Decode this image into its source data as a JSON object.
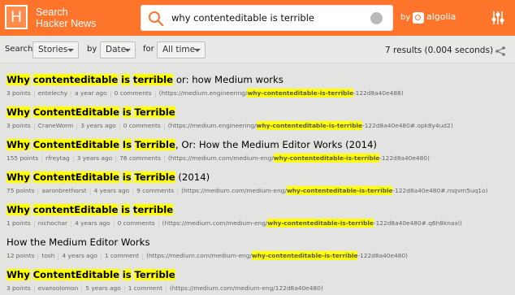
{
  "header": {
    "logo_letter": "H",
    "brand_line1": "Search",
    "brand_line2": "Hacker News",
    "search_value": "why contenteditable is terrible",
    "by_label": "by",
    "algolia_label": "algolia"
  },
  "filters": {
    "search_label": "Search",
    "type_value": "Stories",
    "by_label": "by",
    "sort_value": "Date",
    "for_label": "for",
    "range_value": "All time",
    "results": "7 results (0.004 seconds)"
  },
  "results": [
    {
      "title": [
        {
          "t": "Why",
          "h": true
        },
        {
          "t": " ",
          "h": false
        },
        {
          "t": "contenteditable",
          "h": true
        },
        {
          "t": " ",
          "h": false
        },
        {
          "t": "is",
          "h": true
        },
        {
          "t": " ",
          "h": false
        },
        {
          "t": "terrible",
          "h": true
        },
        {
          "t": " or: how Medium works",
          "h": false
        }
      ],
      "points": "3 points",
      "author": "entelechy",
      "age": "a year ago",
      "comments": "0 comments",
      "url": [
        {
          "t": "(https://medium.engineering/",
          "h": false
        },
        {
          "t": "why-contenteditable-is-terrible",
          "h": true
        },
        {
          "t": "-122d8a40e488)",
          "h": false
        }
      ]
    },
    {
      "title": [
        {
          "t": "Why",
          "h": true
        },
        {
          "t": " ",
          "h": false
        },
        {
          "t": "ContentEditable",
          "h": true
        },
        {
          "t": " ",
          "h": false
        },
        {
          "t": "is",
          "h": true
        },
        {
          "t": " ",
          "h": false
        },
        {
          "t": "Terrible",
          "h": true
        }
      ],
      "points": "3 points",
      "author": "CraneWorm",
      "age": "3 years ago",
      "comments": "0 comments",
      "url": [
        {
          "t": "(https://medium.engineering/",
          "h": false
        },
        {
          "t": "why-contenteditable-is-terrible",
          "h": true
        },
        {
          "t": "-122d8a40e480#.opk8y4ud2)",
          "h": false
        }
      ]
    },
    {
      "title": [
        {
          "t": "Why",
          "h": true
        },
        {
          "t": " ",
          "h": false
        },
        {
          "t": "ContentEditable",
          "h": true
        },
        {
          "t": " ",
          "h": false
        },
        {
          "t": "Is",
          "h": true
        },
        {
          "t": " ",
          "h": false
        },
        {
          "t": "Terrible",
          "h": true
        },
        {
          "t": ", Or: How the Medium Editor Works (2014)",
          "h": false
        }
      ],
      "points": "155 points",
      "author": "rfreytag",
      "age": "3 years ago",
      "comments": "76 comments",
      "url": [
        {
          "t": "(https://medium.com/medium-eng/",
          "h": false
        },
        {
          "t": "why-contenteditable-is-terrible",
          "h": true
        },
        {
          "t": "-122d8a40e480)",
          "h": false
        }
      ]
    },
    {
      "title": [
        {
          "t": "Why",
          "h": true
        },
        {
          "t": " ",
          "h": false
        },
        {
          "t": "ContentEditable",
          "h": true
        },
        {
          "t": " ",
          "h": false
        },
        {
          "t": "is",
          "h": true
        },
        {
          "t": " ",
          "h": false
        },
        {
          "t": "Terrible",
          "h": true
        },
        {
          "t": " (2014)",
          "h": false
        }
      ],
      "points": "75 points",
      "author": "aaronbrethorst",
      "age": "4 years ago",
      "comments": "9 comments",
      "url": [
        {
          "t": "(https://medium.com/medium-eng/",
          "h": false
        },
        {
          "t": "why-contenteditable-is-terrible",
          "h": true
        },
        {
          "t": "-122d8a40e480#.mqvm5uq1o)",
          "h": false
        }
      ]
    },
    {
      "title": [
        {
          "t": "Why",
          "h": true
        },
        {
          "t": " ",
          "h": false
        },
        {
          "t": "contentEditable",
          "h": true
        },
        {
          "t": " ",
          "h": false
        },
        {
          "t": "is",
          "h": true
        },
        {
          "t": " ",
          "h": false
        },
        {
          "t": "terrible",
          "h": true
        }
      ],
      "points": "1 points",
      "author": "nichochar",
      "age": "4 years ago",
      "comments": "0 comments",
      "url": [
        {
          "t": "(https://medium.com/medium-eng/",
          "h": false
        },
        {
          "t": "why-contenteditable-is-terrible",
          "h": true
        },
        {
          "t": "-122d8a40e480#.q6h8knaxl)",
          "h": false
        }
      ]
    },
    {
      "title": [
        {
          "t": "How the Medium Editor Works",
          "h": false
        }
      ],
      "points": "12 points",
      "author": "tosh",
      "age": "4 years ago",
      "comments": "1 comment",
      "url": [
        {
          "t": "(https://medium.com/medium-eng/",
          "h": false
        },
        {
          "t": "why-contenteditable-is-terrible",
          "h": true
        },
        {
          "t": "-122d8a40e480)",
          "h": false
        }
      ]
    },
    {
      "title": [
        {
          "t": "Why",
          "h": true
        },
        {
          "t": " ",
          "h": false
        },
        {
          "t": "ContentEditable",
          "h": true
        },
        {
          "t": " ",
          "h": false
        },
        {
          "t": "is",
          "h": true
        },
        {
          "t": " ",
          "h": false
        },
        {
          "t": "Terrible",
          "h": true
        }
      ],
      "points": "3 points",
      "author": "evansolomon",
      "age": "5 years ago",
      "comments": "1 comment",
      "url": [
        {
          "t": "(https://medium.com/medium-eng/122d8a40e480)",
          "h": false
        }
      ]
    }
  ]
}
